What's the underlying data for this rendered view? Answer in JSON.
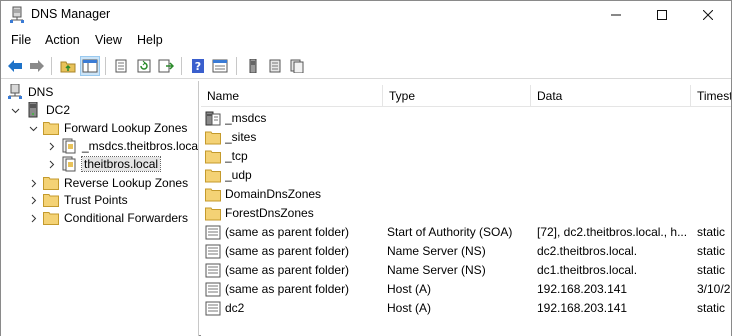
{
  "window": {
    "title": "DNS Manager"
  },
  "menu": [
    "File",
    "Action",
    "View",
    "Help"
  ],
  "toolbar": {
    "buttons": [
      "back-arrow-icon",
      "forward-arrow-icon",
      "up-folder-icon",
      "show-hide-tree-icon",
      "properties-icon",
      "refresh-icon",
      "export-list-icon",
      "help-icon",
      "details-view-icon",
      "server-icon",
      "zone-icon",
      "record-icon"
    ]
  },
  "tree": {
    "root": "DNS",
    "server": "DC2",
    "forward_zones": "Forward Lookup Zones",
    "msdcs_zone": "_msdcs.theitbros.local",
    "selected_zone": "theitbros.local",
    "reverse_zones": "Reverse Lookup Zones",
    "trust_points": "Trust Points",
    "conditional_forwarders": "Conditional Forwarders"
  },
  "list": {
    "columns": [
      "Name",
      "Type",
      "Data",
      "Timest"
    ],
    "rows": [
      {
        "name": "_msdcs",
        "type": "",
        "data": "",
        "timestamp": "",
        "icon": "delegation-icon"
      },
      {
        "name": "_sites",
        "type": "",
        "data": "",
        "timestamp": "",
        "icon": "folder-icon"
      },
      {
        "name": "_tcp",
        "type": "",
        "data": "",
        "timestamp": "",
        "icon": "folder-icon"
      },
      {
        "name": "_udp",
        "type": "",
        "data": "",
        "timestamp": "",
        "icon": "folder-icon"
      },
      {
        "name": "DomainDnsZones",
        "type": "",
        "data": "",
        "timestamp": "",
        "icon": "folder-icon"
      },
      {
        "name": "ForestDnsZones",
        "type": "",
        "data": "",
        "timestamp": "",
        "icon": "folder-icon"
      },
      {
        "name": "(same as parent folder)",
        "type": "Start of Authority (SOA)",
        "data": "[72], dc2.theitbros.local., h...",
        "timestamp": "static",
        "icon": "record-icon"
      },
      {
        "name": "(same as parent folder)",
        "type": "Name Server (NS)",
        "data": "dc2.theitbros.local.",
        "timestamp": "static",
        "icon": "record-icon"
      },
      {
        "name": "(same as parent folder)",
        "type": "Name Server (NS)",
        "data": "dc1.theitbros.local.",
        "timestamp": "static",
        "icon": "record-icon"
      },
      {
        "name": "(same as parent folder)",
        "type": "Host (A)",
        "data": "192.168.203.141",
        "timestamp": "3/10/2",
        "icon": "record-icon"
      },
      {
        "name": "dc2",
        "type": "Host (A)",
        "data": "192.168.203.141",
        "timestamp": "static",
        "icon": "record-icon"
      }
    ]
  },
  "colors": {
    "folder": "#e8c25a",
    "selection": "#cce4f7",
    "accent_blue": "#1e72c8"
  }
}
